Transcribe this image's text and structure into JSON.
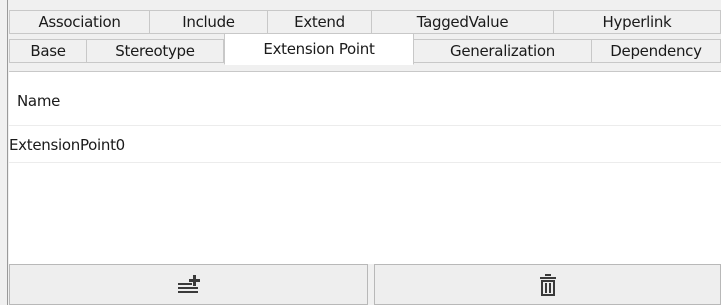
{
  "tabs_row1": [
    "Association",
    "Include",
    "Extend",
    "TaggedValue",
    "Hyperlink"
  ],
  "tabs_row2": [
    "Base",
    "Stereotype",
    "Extension Point",
    "Generalization",
    "Dependency"
  ],
  "active_tab": "Extension Point",
  "list": {
    "header": "Name",
    "items": [
      "ExtensionPoint0"
    ]
  },
  "toolbar": {
    "add_icon": "add-list-icon",
    "delete_icon": "trash-icon"
  }
}
